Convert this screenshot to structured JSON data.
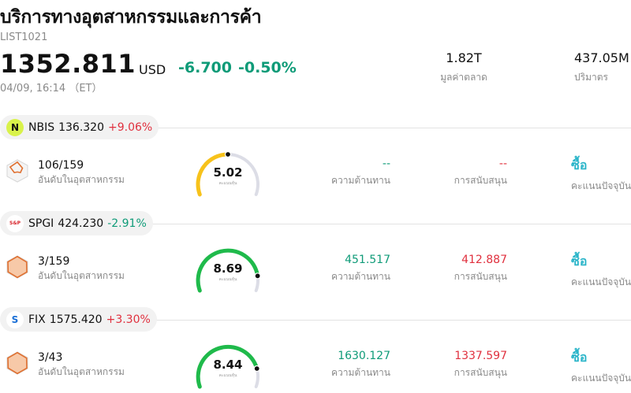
{
  "header": {
    "title": "บริการทางอุตสาหกรรมและการค้า",
    "code": "LIST1021",
    "price": "1352.811",
    "currency": "USD",
    "change": "-6.700",
    "change_pct": "-0.50%",
    "time": "04/09, 16:14 （ET）",
    "market_cap": {
      "value": "1.82T",
      "label": "มูลค่าตลาด"
    },
    "volume": {
      "value": "437.05M",
      "label": "ปริมาตร"
    }
  },
  "labels": {
    "rank": "อันดับในอุตสาหกรรม",
    "score_sub": "คะแนนหุ้น",
    "resistance": "ความต้านทาน",
    "support": "การสนับสนุน",
    "rating": "คะแนนปัจจุบัน"
  },
  "colors": {
    "up": "#e0303e",
    "down": "#0f9b78",
    "rating": "#2bb5c9",
    "gauge_track": "#dcdde6"
  },
  "stocks": [
    {
      "ticker": "NBIS",
      "price": "136.320",
      "pct": "+9.06%",
      "direction": "up",
      "logo_icon": "nebius-logo-icon",
      "logo_text": "N",
      "logo_bg": "#d9f24a",
      "logo_fg": "#111111",
      "rank": "106/159",
      "rank_icon_color": "#e07030",
      "rank_fill": 0.25,
      "score": "5.02",
      "score_fraction": 0.5,
      "gauge_color": "#f7c21b",
      "resistance": "--",
      "support": "--",
      "rating": "ซื้อ"
    },
    {
      "ticker": "SPGI",
      "price": "424.230",
      "pct": "-2.91%",
      "direction": "down",
      "logo_icon": "sp-global-logo-icon",
      "logo_text": "S&P",
      "logo_bg": "#ffffff",
      "logo_fg": "#d8232a",
      "rank": "3/159",
      "rank_icon_color": "#e07030",
      "rank_fill": 0.95,
      "score": "8.69",
      "score_fraction": 0.87,
      "gauge_color": "#1fba4b",
      "resistance": "451.517",
      "support": "412.887",
      "rating": "ซื้อ"
    },
    {
      "ticker": "FIX",
      "price": "1575.420",
      "pct": "+3.30%",
      "direction": "up",
      "logo_icon": "comfort-systems-logo-icon",
      "logo_text": "S",
      "logo_bg": "#ffffff",
      "logo_fg": "#1a6fd6",
      "rank": "3/43",
      "rank_icon_color": "#e07030",
      "rank_fill": 0.93,
      "score": "8.44",
      "score_fraction": 0.84,
      "gauge_color": "#1fba4b",
      "resistance": "1630.127",
      "support": "1337.597",
      "rating": "ซื้อ"
    }
  ]
}
